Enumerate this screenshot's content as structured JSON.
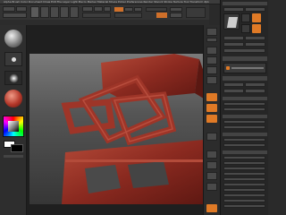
{
  "app": {
    "name": "ZBrush"
  },
  "topbar": {
    "menus": [
      "Alpha",
      "Brush",
      "Color",
      "Document",
      "Draw",
      "Edit",
      "File",
      "Layer",
      "Light",
      "Macro",
      "Marker",
      "Material",
      "Movie",
      "Picker",
      "Preferences",
      "Render",
      "Stencil",
      "Stroke",
      "Texture",
      "Tool",
      "Transform",
      "Zplugin",
      "Zscript"
    ]
  },
  "toolbar": {
    "items": [
      "Projection Master",
      "LightBox",
      "Quick Sketch",
      "Edit",
      "Draw",
      "Move",
      "Scale",
      "Rotate",
      "Mrgb",
      "Rgb",
      "M",
      "Zadd",
      "Zsub",
      "Zcut",
      "Focal Shift 0",
      "Draw Size 64",
      "Z Intensity 25"
    ]
  },
  "left_shelf": {
    "brush": "Standard",
    "stroke": "DragRect",
    "alpha": "Off",
    "material": "Red Wax",
    "colors": {
      "primary": "#ffffff",
      "secondary": "#000000"
    }
  },
  "right_tray": {
    "section_title": "Tool",
    "buttons": [
      "Load Tool",
      "Save As",
      "Copy Tool",
      "Import",
      "Export",
      "Clone",
      "Make PolyMesh3D",
      "GoZ",
      "All",
      "Visible",
      "R"
    ],
    "subtool_list": [
      "SubTool",
      "Geometry",
      "Layers",
      "FiberMesh",
      "Geometry HD",
      "Preview",
      "Surface",
      "Deformation",
      "Masking",
      "Visibility",
      "Polygroups",
      "Contact",
      "Morph Target",
      "Polypaint",
      "UV Map",
      "Texture Map",
      "Displacement Map",
      "Normal Map",
      "Unified Skin",
      "Initialize",
      "Import",
      "Export"
    ]
  },
  "colors": {
    "accent": "#e07a26",
    "model": "#8b2a20"
  }
}
